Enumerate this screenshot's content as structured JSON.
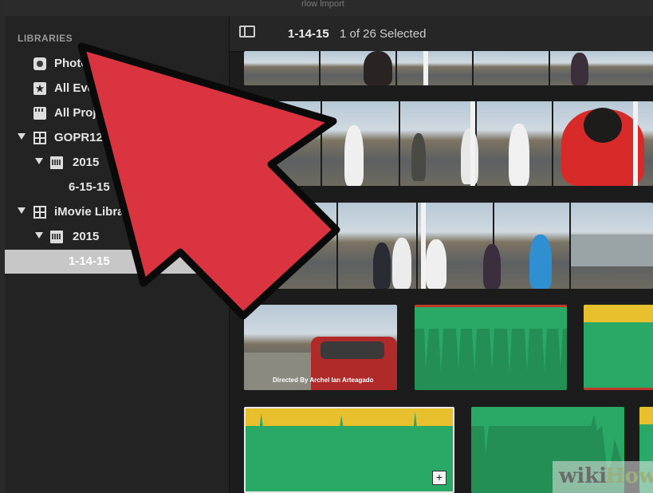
{
  "window": {
    "title_fragment": "rlow    lmport"
  },
  "sidebar": {
    "heading": "LIBRARIES",
    "items": [
      {
        "label": "Photos Library",
        "icon": "photos-icon"
      },
      {
        "label": "All Events",
        "icon": "star-icon"
      },
      {
        "label": "All Projects",
        "icon": "clapper-icon"
      },
      {
        "label": "GOPR1253",
        "icon": "library-grid-icon"
      },
      {
        "label": "2015",
        "icon": "calendar-icon"
      },
      {
        "label": "6-15-15"
      },
      {
        "label": "iMovie Library",
        "icon": "library-grid-icon"
      },
      {
        "label": "2015",
        "icon": "calendar-icon"
      },
      {
        "label": "1-14-15",
        "icon": "clip-icon",
        "selected": true
      }
    ]
  },
  "browser": {
    "event_title": "1-14-15",
    "selection_status": "1 of 26 Selected",
    "clip_credit": "Directed By Archel Ian Arteagado"
  },
  "watermark": {
    "part1": "wiki",
    "part2": "How"
  },
  "colors": {
    "arrow_red": "#d9343f",
    "audio_green": "#2aa866",
    "audio_yellow": "#e8c02e",
    "selected_row": "#c7c7c7"
  }
}
